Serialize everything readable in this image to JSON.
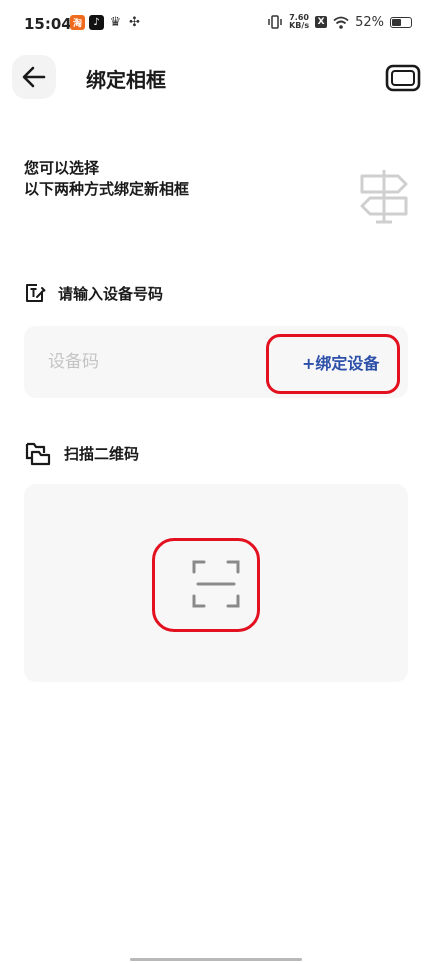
{
  "status_bar": {
    "time": "15:04",
    "notif_app1": "淘",
    "notif_app2": "♪",
    "notif_app3": "♛",
    "notif_app4": "✣",
    "net_speed_value": "7.60",
    "net_speed_unit": "KB/s",
    "sim_label": "X",
    "battery_percent": "52%",
    "battery_level": 0.52
  },
  "header": {
    "title": "绑定相框"
  },
  "intro": {
    "line1": "您可以选择",
    "line2": "以下两种方式绑定新相框"
  },
  "device_section": {
    "label": "请输入设备号码",
    "input_placeholder": "设备码",
    "input_value": "",
    "bind_button": "+绑定设备"
  },
  "scan_section": {
    "label": "扫描二维码"
  },
  "colors": {
    "accent": "#2c4fa8",
    "annotation_red": "#e3101f",
    "card_bg": "#f7f7f7"
  }
}
